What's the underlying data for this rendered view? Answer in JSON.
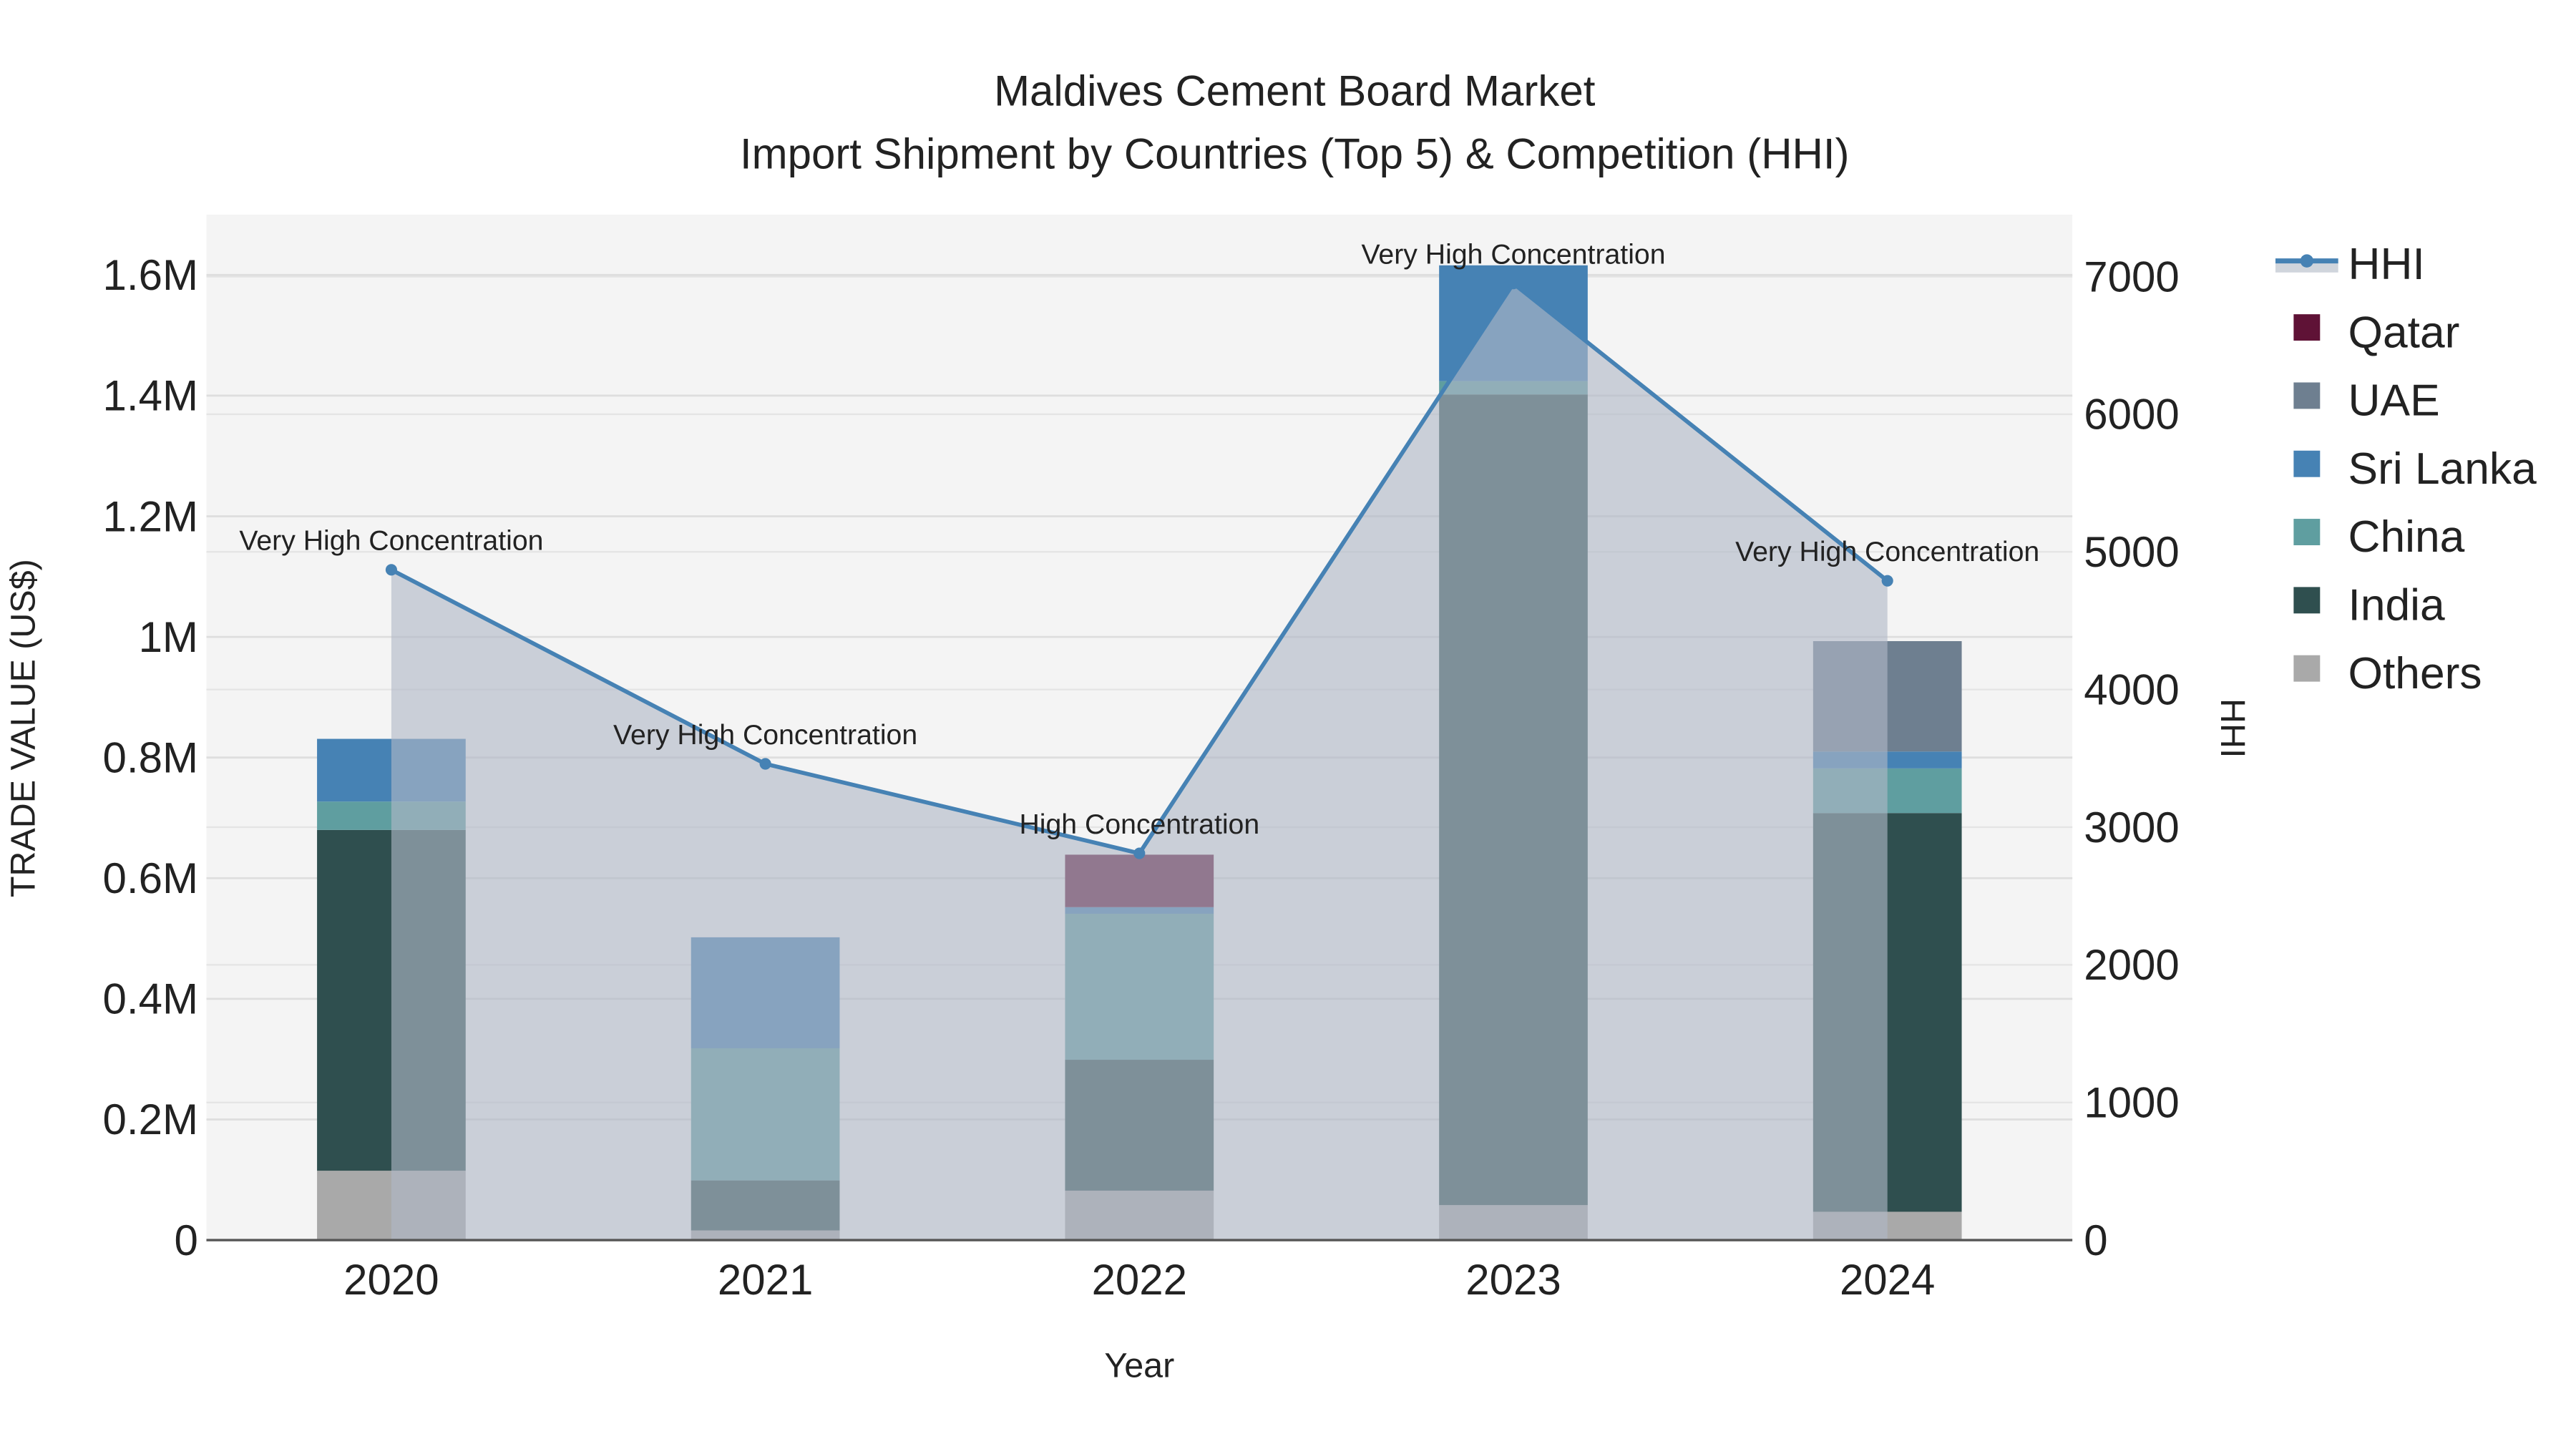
{
  "chart_data": {
    "type": "bar",
    "title": "Maldives Cement Board Market",
    "subtitle": "Import Shipment by Countries (Top 5) & Competition (HHI)",
    "xlabel": "Year",
    "ylabel": "TRADE VALUE (US$)",
    "y2label": "HHI",
    "categories": [
      "2020",
      "2021",
      "2022",
      "2023",
      "2024"
    ],
    "ylim": [
      0,
      1700000
    ],
    "y2lim": [
      0,
      7450
    ],
    "yticks": [
      0,
      200000,
      400000,
      600000,
      800000,
      1000000,
      1200000,
      1400000,
      1600000
    ],
    "ytick_labels": [
      "0",
      "0.2M",
      "0.4M",
      "0.6M",
      "0.8M",
      "1M",
      "1.2M",
      "1.4M",
      "1.6M"
    ],
    "y2ticks": [
      0,
      1000,
      2000,
      3000,
      4000,
      5000,
      6000,
      7000
    ],
    "y2tick_labels": [
      "0",
      "1000",
      "2000",
      "3000",
      "4000",
      "5000",
      "6000",
      "7000"
    ],
    "grid": true,
    "legend_position": "right",
    "series": [
      {
        "name": "Others",
        "color": "#a9a9a9",
        "values": [
          115000,
          16000,
          82000,
          58000,
          47000
        ]
      },
      {
        "name": "India",
        "color": "#2f4f4f",
        "values": [
          565000,
          83000,
          217000,
          1344000,
          661000
        ]
      },
      {
        "name": "China",
        "color": "#5f9ea0",
        "values": [
          47000,
          219000,
          242000,
          22000,
          74000
        ]
      },
      {
        "name": "Sri Lanka",
        "color": "#4682b4",
        "values": [
          104000,
          184000,
          11000,
          192000,
          28000
        ]
      },
      {
        "name": "UAE",
        "color": "#6e7f90",
        "values": [
          0,
          0,
          0,
          0,
          183000
        ]
      },
      {
        "name": "Qatar",
        "color": "#5f1236",
        "values": [
          0,
          0,
          87000,
          0,
          0
        ]
      }
    ],
    "hhi": {
      "name": "HHI",
      "color": "#4682b4",
      "values": [
        4870,
        3460,
        2810,
        6950,
        4790
      ],
      "annotations": [
        "Very High Concentration",
        "Very High Concentration",
        "High Concentration",
        "Very High Concentration",
        "Very High Concentration"
      ]
    },
    "legend": [
      "HHI",
      "Qatar",
      "UAE",
      "Sri Lanka",
      "China",
      "India",
      "Others"
    ]
  }
}
